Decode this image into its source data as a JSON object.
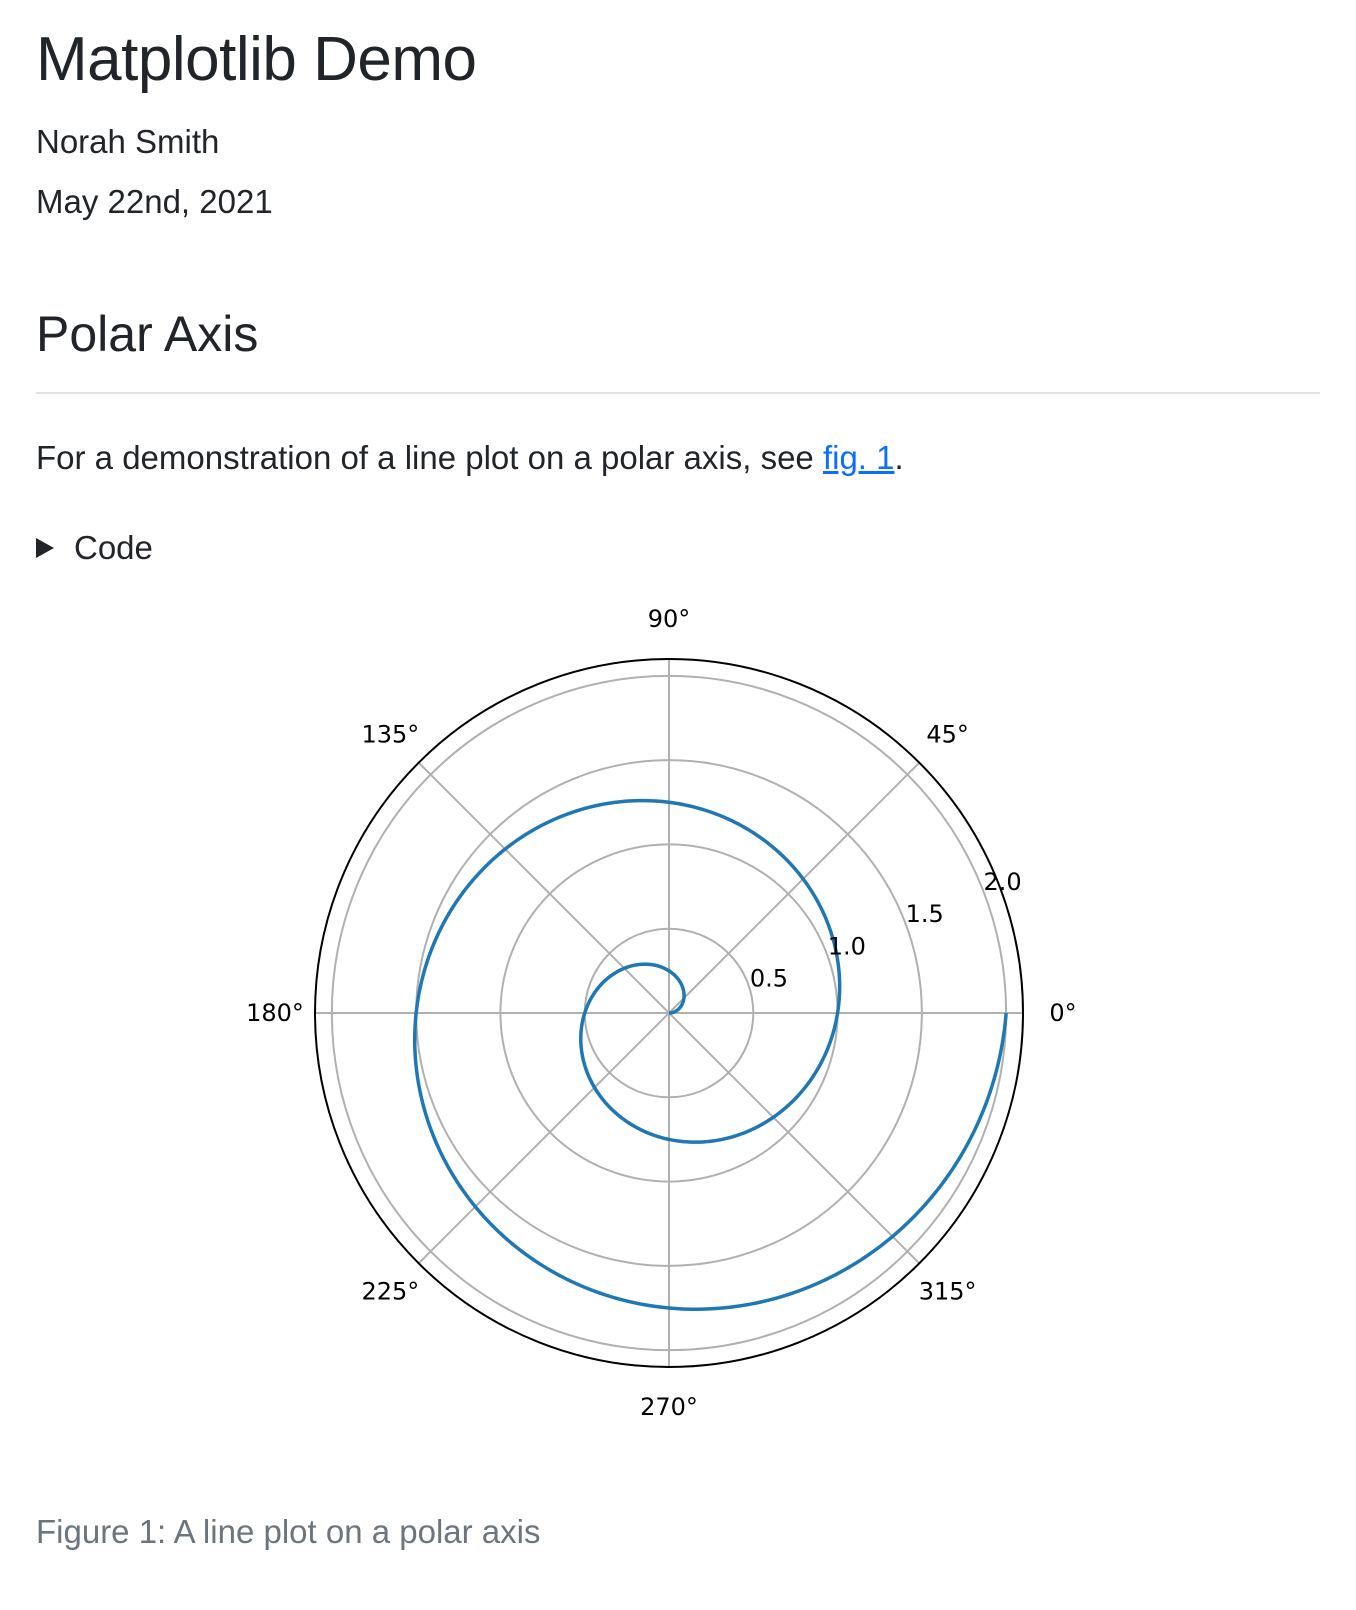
{
  "document": {
    "title": "Matplotlib Demo",
    "author": "Norah Smith",
    "date": "May 22nd, 2021"
  },
  "section": {
    "title": "Polar Axis",
    "paragraph_text": "For a demonstration of a line plot on a polar axis, see ",
    "link_text": "fig. 1",
    "paragraph_end": "."
  },
  "code_toggle": {
    "label": "Code"
  },
  "figure": {
    "caption": "Figure 1: A line plot on a polar axis"
  },
  "colors": {
    "text": "#212529",
    "link": "#0d6efd",
    "caption": "#6c757d",
    "rule": "#dee2e6",
    "grid": "#b0b0b0",
    "series": "#1f77b4"
  },
  "chart_data": {
    "type": "line",
    "projection": "polar",
    "title": "",
    "angle_unit": "degrees",
    "theta_ticks": [
      0,
      45,
      90,
      135,
      180,
      225,
      270,
      315
    ],
    "theta_tick_labels": [
      "0°",
      "45°",
      "90°",
      "135°",
      "180°",
      "225°",
      "270°",
      "315°"
    ],
    "r_ticks": [
      0.5,
      1.0,
      1.5,
      2.0
    ],
    "r_tick_labels": [
      "0.5",
      "1.0",
      "1.5",
      "2.0"
    ],
    "r_label_angle_deg": 22.5,
    "rlim": [
      0,
      2.1
    ],
    "grid": true,
    "series": [
      {
        "r_start": 0,
        "r_end": 2.0,
        "r_step": 0.01,
        "theta_expression": "2 * pi * r",
        "color": "#1f77b4"
      }
    ]
  }
}
